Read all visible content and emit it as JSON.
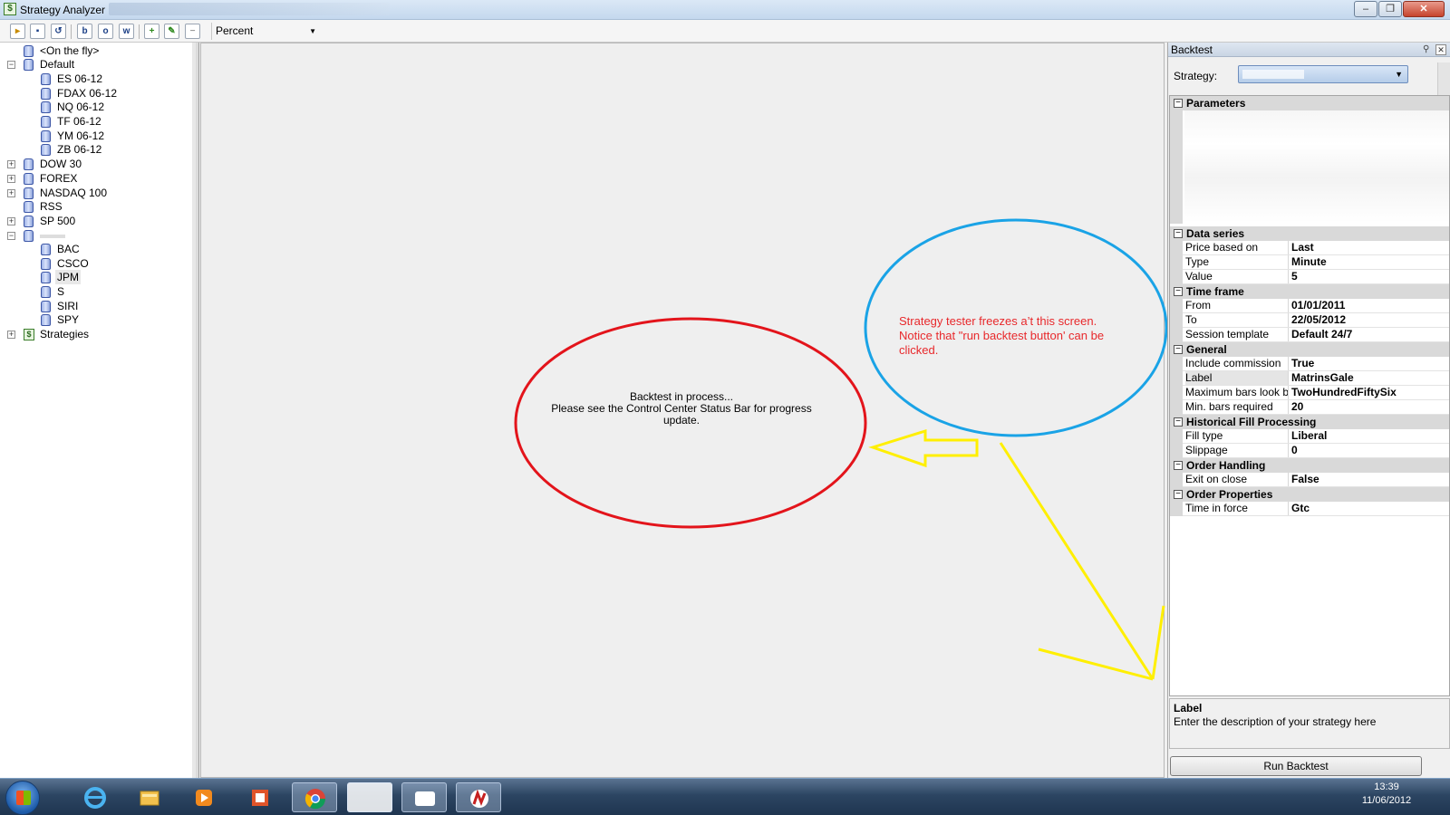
{
  "window": {
    "title": "Strategy Analyzer"
  },
  "toolbar": {
    "display_unit": "Percent",
    "buttons": [
      "open-icon",
      "save-icon",
      "history-icon",
      "b",
      "o",
      "w",
      "add-icon",
      "edit-icon",
      "remove-icon"
    ]
  },
  "tree": {
    "items": [
      {
        "label": "<On the fly>",
        "icon": "database-icon",
        "level": 1
      },
      {
        "label": "Default",
        "icon": "database-icon",
        "level": 0,
        "expander": "−"
      },
      {
        "label": "ES 06-12",
        "icon": "database-icon",
        "level": 2
      },
      {
        "label": "FDAX 06-12",
        "icon": "database-icon",
        "level": 2
      },
      {
        "label": "NQ 06-12",
        "icon": "database-icon",
        "level": 2
      },
      {
        "label": "TF 06-12",
        "icon": "database-icon",
        "level": 2
      },
      {
        "label": "YM 06-12",
        "icon": "database-icon",
        "level": 2
      },
      {
        "label": "ZB 06-12",
        "icon": "database-icon",
        "level": 2
      },
      {
        "label": "DOW 30",
        "icon": "database-icon",
        "level": 0,
        "expander": "+"
      },
      {
        "label": "FOREX",
        "icon": "database-icon",
        "level": 0,
        "expander": "+"
      },
      {
        "label": "NASDAQ 100",
        "icon": "database-icon",
        "level": 0,
        "expander": "+"
      },
      {
        "label": "RSS",
        "icon": "database-icon",
        "level": 1
      },
      {
        "label": "SP 500",
        "icon": "database-icon",
        "level": 0,
        "expander": "+"
      },
      {
        "label": "",
        "icon": "database-icon",
        "level": 0,
        "expander": "−"
      },
      {
        "label": "BAC",
        "icon": "database-icon",
        "level": 2
      },
      {
        "label": "CSCO",
        "icon": "database-icon",
        "level": 2
      },
      {
        "label": "JPM",
        "icon": "database-icon",
        "level": 2
      },
      {
        "label": "S",
        "icon": "database-icon",
        "level": 2
      },
      {
        "label": "SIRI",
        "icon": "database-icon",
        "level": 2
      },
      {
        "label": "SPY",
        "icon": "database-icon",
        "level": 2
      },
      {
        "label": "Strategies",
        "icon": "dollar-icon",
        "level": 0,
        "expander": "+"
      }
    ]
  },
  "main": {
    "status_line1": "Backtest in process...",
    "status_line2": "Please see the Control Center Status Bar for progress update.",
    "annotation": "Strategy tester freezes a’t this screen. Notice that \"run backtest button' can be clicked.",
    "annotation_color": "#e8282b",
    "circle_red": "#e3141b",
    "circle_blue": "#1aa3e6",
    "arrow_yellow": "#ffef00"
  },
  "backtest_panel": {
    "title": "Backtest",
    "strategy_label": "Strategy:",
    "categories": {
      "parameters": "Parameters",
      "data_series": "Data series",
      "time_frame": "Time frame",
      "general": "General",
      "historical_fill": "Historical Fill Processing",
      "order_handling": "Order Handling",
      "order_properties": "Order Properties"
    },
    "data_series": [
      {
        "name": "Price based on",
        "value": "Last"
      },
      {
        "name": "Type",
        "value": "Minute"
      },
      {
        "name": "Value",
        "value": "5"
      }
    ],
    "time_frame": [
      {
        "name": "From",
        "value": "01/01/2011"
      },
      {
        "name": "To",
        "value": "22/05/2012"
      },
      {
        "name": "Session template",
        "value": "Default 24/7"
      }
    ],
    "general": [
      {
        "name": "Include commission",
        "value": "True"
      },
      {
        "name": "Label",
        "value": "MatrinsGale"
      },
      {
        "name": "Maximum bars look bac",
        "value": "TwoHundredFiftySix"
      },
      {
        "name": "Min. bars required",
        "value": "20"
      }
    ],
    "historical_fill": [
      {
        "name": "Fill type",
        "value": "Liberal"
      },
      {
        "name": "Slippage",
        "value": "0"
      }
    ],
    "order_handling": [
      {
        "name": "Exit on close",
        "value": "False"
      }
    ],
    "order_properties": [
      {
        "name": "Time in force",
        "value": "Gtc"
      }
    ],
    "description_title": "Label",
    "description_text": "Enter the description of your strategy here",
    "run_button": "Run Backtest"
  },
  "taskbar": {
    "time": "13:39",
    "date": "11/06/2012",
    "apps": [
      "internet-explorer-icon",
      "file-explorer-icon",
      "media-player-icon",
      "office-icon",
      "chrome-icon",
      "window-thumbnail-1",
      "window-thumbnail-2",
      "ninjatrader-icon"
    ]
  }
}
